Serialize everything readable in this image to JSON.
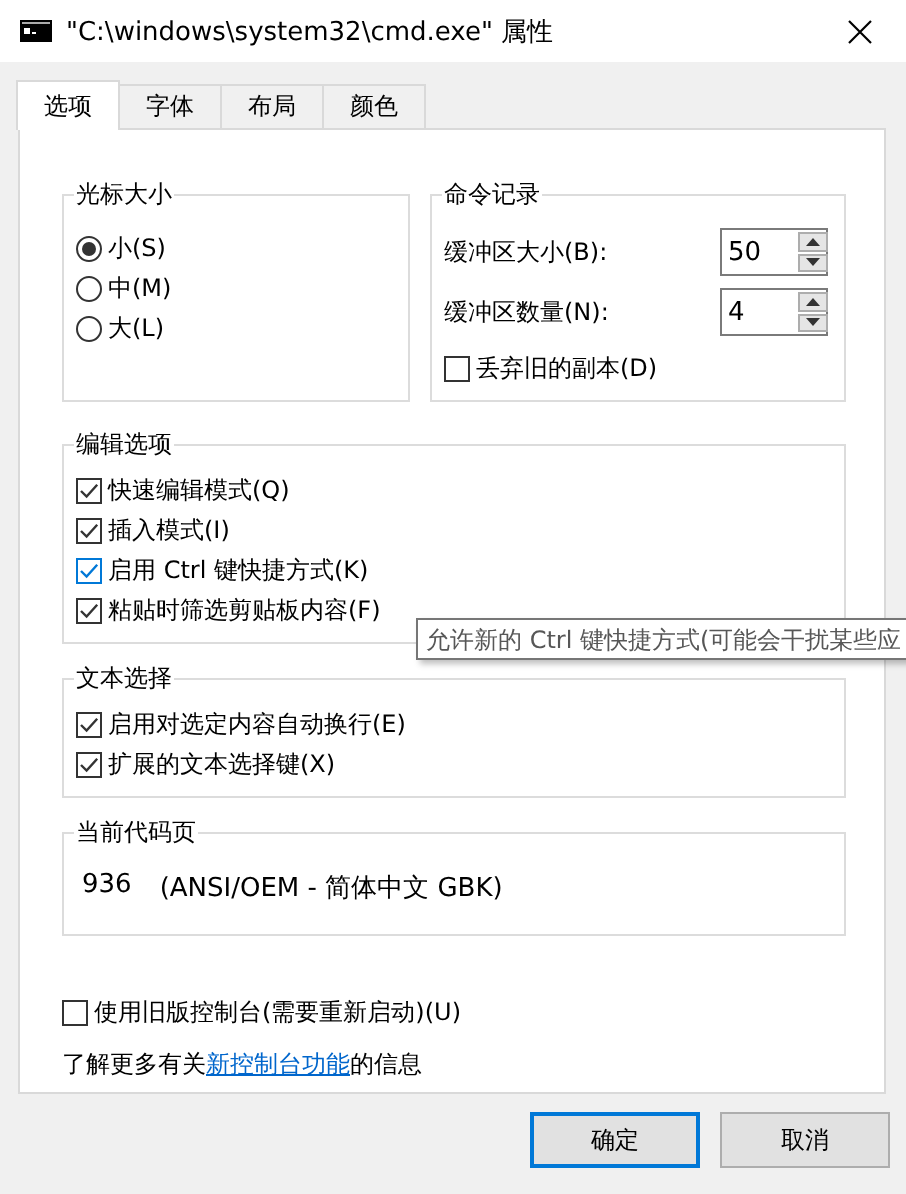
{
  "window": {
    "title": "\"C:\\windows\\system32\\cmd.exe\" 属性"
  },
  "tabs": [
    {
      "label": "选项",
      "selected": true
    },
    {
      "label": "字体",
      "selected": false
    },
    {
      "label": "布局",
      "selected": false
    },
    {
      "label": "颜色",
      "selected": false
    }
  ],
  "cursor_size": {
    "title": "光标大小",
    "options": [
      {
        "label": "小(S)",
        "selected": true
      },
      {
        "label": "中(M)",
        "selected": false
      },
      {
        "label": "大(L)",
        "selected": false
      }
    ]
  },
  "command_history": {
    "title": "命令记录",
    "fields": [
      {
        "label": "缓冲区大小(B):",
        "value": "50"
      },
      {
        "label": "缓冲区数量(N):",
        "value": "4"
      }
    ],
    "discard": {
      "label": "丢弃旧的副本(D)",
      "checked": false
    }
  },
  "edit_options": {
    "title": "编辑选项",
    "items": [
      {
        "label": "快速编辑模式(Q)",
        "checked": true
      },
      {
        "label": "插入模式(I)",
        "checked": true
      },
      {
        "label": "启用 Ctrl 键快捷方式(K)",
        "checked": true,
        "hovered": true
      },
      {
        "label": "粘贴时筛选剪贴板内容(F)",
        "checked": true
      }
    ]
  },
  "text_selection": {
    "title": "文本选择",
    "items": [
      {
        "label": "启用对选定内容自动换行(E)",
        "checked": true
      },
      {
        "label": "扩展的文本选择键(X)",
        "checked": true
      }
    ]
  },
  "code_page": {
    "title": "当前代码页",
    "code": "936",
    "description": "(ANSI/OEM - 简体中文 GBK)"
  },
  "legacy_console": {
    "label": "使用旧版控制台(需要重新启动)(U)",
    "checked": false
  },
  "info": {
    "prefix": "了解更多有关",
    "link": "新控制台功能",
    "suffix": "的信息"
  },
  "tooltip": {
    "text": "允许新的 Ctrl 键快捷方式(可能会干扰某些应"
  },
  "buttons": [
    {
      "label": "确定",
      "default": true
    },
    {
      "label": "取消",
      "default": false
    }
  ]
}
